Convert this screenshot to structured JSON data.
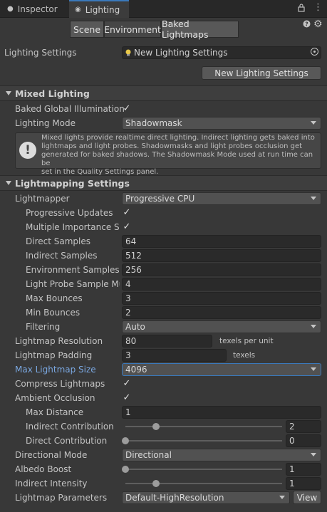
{
  "tabs": {
    "inspector": "Inspector",
    "lighting": "Lighting",
    "inspector_icon": "info-icon",
    "lighting_icon": "lightbulb-icon"
  },
  "window_icons": [
    "lock-icon",
    "more-menu-icon"
  ],
  "subtabs": [
    "Scene",
    "Environment",
    "Baked Lightmaps"
  ],
  "corner_icons": [
    "help-icon",
    "settings-gear-icon"
  ],
  "lighting_settings": {
    "label": "Lighting Settings",
    "asset": "New Lighting Settings",
    "new_button": "New Lighting Settings"
  },
  "mixed_lighting": {
    "title": "Mixed Lighting",
    "baked_gi_label": "Baked Global Illumination",
    "baked_gi": true,
    "lighting_mode_label": "Lighting Mode",
    "lighting_mode": "Shadowmask",
    "help_lines": [
      "Mixed lights provide realtime direct lighting. Indirect lighting gets baked into",
      "lightmaps and light probes. Shadowmasks and light probes occlusion get",
      "generated for baked shadows. The Shadowmask Mode used at run time can be",
      "set in the Quality Settings panel."
    ]
  },
  "lightmapping": {
    "title": "Lightmapping Settings",
    "lightmapper_label": "Lightmapper",
    "lightmapper": "Progressive CPU",
    "progressive_updates_label": "Progressive Updates",
    "multiple_importance_label": "Multiple Importance Sar",
    "direct_samples_label": "Direct Samples",
    "direct_samples": "64",
    "indirect_samples_label": "Indirect Samples",
    "indirect_samples": "512",
    "environment_samples_label": "Environment Samples",
    "environment_samples": "256",
    "light_probe_mul_label": "Light Probe Sample Mul",
    "light_probe_mul": "4",
    "max_bounces_label": "Max Bounces",
    "max_bounces": "3",
    "min_bounces_label": "Min Bounces",
    "min_bounces": "2",
    "filtering_label": "Filtering",
    "filtering": "Auto",
    "resolution_label": "Lightmap Resolution",
    "resolution": "80",
    "resolution_unit": "texels per unit",
    "padding_label": "Lightmap Padding",
    "padding": "3",
    "padding_unit": "texels",
    "max_size_label": "Max Lightmap Size",
    "max_size": "4096",
    "compress_label": "Compress Lightmaps",
    "ambient_occlusion_label": "Ambient Occlusion",
    "max_distance_label": "Max Distance",
    "max_distance": "1",
    "indirect_contribution_label": "Indirect Contribution",
    "indirect_contribution": "2",
    "direct_contribution_label": "Direct Contribution",
    "direct_contribution": "0",
    "directional_mode_label": "Directional Mode",
    "directional_mode": "Directional",
    "albedo_boost_label": "Albedo Boost",
    "albedo_boost": "1",
    "indirect_intensity_label": "Indirect Intensity",
    "indirect_intensity": "1",
    "parameters_label": "Lightmap Parameters",
    "parameters": "Default-HighResolution",
    "view_button": "View"
  }
}
